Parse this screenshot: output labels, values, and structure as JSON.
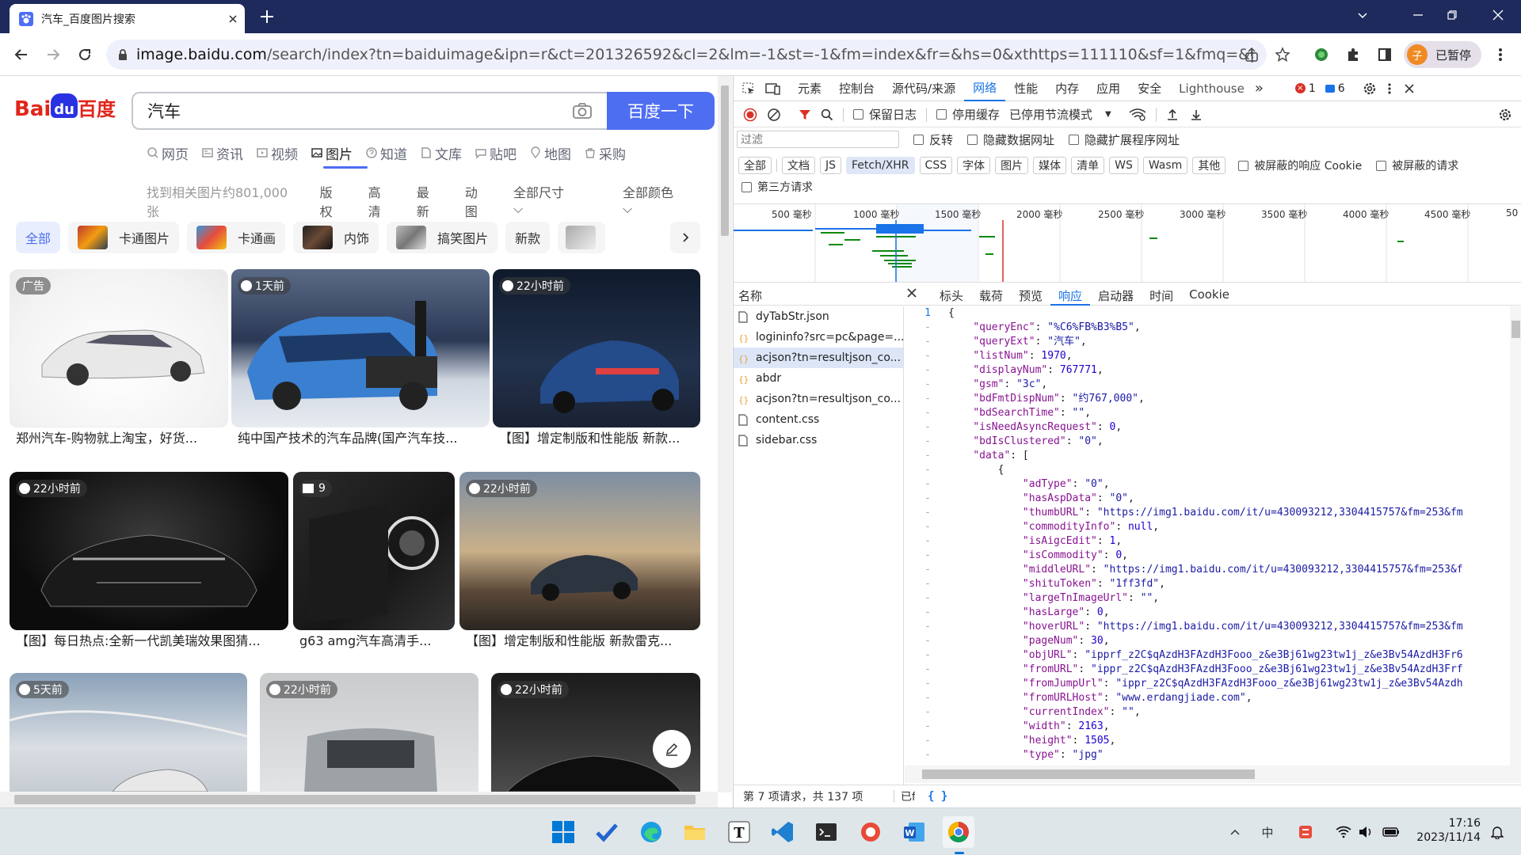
{
  "browser": {
    "tab_title": "汽车_百度图片搜索",
    "url_host": "image.baidu.com",
    "url_rest": "/search/index?tn=baiduimage&ipn=r&ct=201326592&cl=2&lm=-1&st=-1&fm=index&fr=&hs=0&xthttps=111110&sf=1&fmq=&pv=&ic=0&n...",
    "profile_initial": "子",
    "profile_status": "已暂停"
  },
  "page": {
    "logo_text": "Bai",
    "logo_du": "du",
    "logo_cn": "百度",
    "query": "汽车",
    "search_button": "百度一下",
    "nav_tabs": [
      "网页",
      "资讯",
      "视频",
      "图片",
      "知道",
      "文库",
      "贴吧",
      "地图",
      "采购"
    ],
    "result_count": "找到相关图片约801,000张",
    "filters": [
      "版权",
      "高清",
      "最新",
      "动图",
      "全部尺寸",
      "全部颜色"
    ],
    "chips": [
      "全部",
      "卡通图片",
      "卡通画",
      "内饰",
      "搞笑图片",
      "新款"
    ],
    "cards": [
      {
        "badge": "广告",
        "caption": "郑州汽车-购物就上淘宝，好货..."
      },
      {
        "badge": "1天前",
        "caption": "纯中国产技术的汽车品牌(国产汽车技..."
      },
      {
        "badge": "22小时前",
        "caption": "【图】增定制版和性能版 新款..."
      },
      {
        "badge": "22小时前",
        "caption": "【图】每日热点:全新一代凯美瑞效果图猜..."
      },
      {
        "badge": "9",
        "caption": "g63 amg汽车高清手..."
      },
      {
        "badge": "22小时前",
        "caption": "【图】增定制版和性能版 新款雷克..."
      },
      {
        "badge": "5天前",
        "caption": ""
      },
      {
        "badge": "22小时前",
        "caption": ""
      },
      {
        "badge": "22小时前",
        "caption": ""
      }
    ]
  },
  "devtools": {
    "tabs": [
      "元素",
      "控制台",
      "源代码/来源",
      "网络",
      "性能",
      "内存",
      "应用",
      "安全",
      "Lighthouse"
    ],
    "error_count": "1",
    "message_count": "6",
    "toolbar": {
      "preserve_log": "保留日志",
      "disable_cache": "停用缓存",
      "throttle": "已停用节流模式"
    },
    "filter_placeholder": "过滤",
    "filter_checks": [
      "反转",
      "隐藏数据网址",
      "隐藏扩展程序网址"
    ],
    "types": [
      "全部",
      "文档",
      "JS",
      "Fetch/XHR",
      "CSS",
      "字体",
      "图片",
      "媒体",
      "清单",
      "WS",
      "Wasm",
      "其他"
    ],
    "type_checks": [
      "被屏蔽的响应 Cookie",
      "被屏蔽的请求"
    ],
    "third_party": "第三方请求",
    "timeline_ticks": [
      "500 毫秒",
      "1000 毫秒",
      "1500 毫秒",
      "2000 毫秒",
      "2500 毫秒",
      "3000 毫秒",
      "3500 毫秒",
      "4000 毫秒",
      "4500 毫秒",
      "50"
    ],
    "name_header": "名称",
    "detail_tabs": [
      "标头",
      "载荷",
      "预览",
      "响应",
      "启动器",
      "时间",
      "Cookie"
    ],
    "requests": [
      {
        "name": "dyTabStr.json",
        "icon": "doc"
      },
      {
        "name": "logininfo?src=pc&page=...",
        "icon": "xhr"
      },
      {
        "name": "acjson?tn=resultjson_co...",
        "icon": "xhr"
      },
      {
        "name": "abdr",
        "icon": "xhr"
      },
      {
        "name": "acjson?tn=resultjson_co...",
        "icon": "xhr"
      },
      {
        "name": "content.css",
        "icon": "doc"
      },
      {
        "name": "sidebar.css",
        "icon": "doc"
      }
    ],
    "status": "第 7 项请求，共 137 项",
    "status2": "已f",
    "code_lines": [
      {
        "gutter": "1",
        "text": "{"
      },
      {
        "gutter": "-",
        "text": "    \"queryEnc\": \"%C6%FB%B3%B5\","
      },
      {
        "gutter": "-",
        "text": "    \"queryExt\": \"汽车\","
      },
      {
        "gutter": "-",
        "text": "    \"listNum\": 1970,"
      },
      {
        "gutter": "-",
        "text": "    \"displayNum\": 767771,"
      },
      {
        "gutter": "-",
        "text": "    \"gsm\": \"3c\","
      },
      {
        "gutter": "-",
        "text": "    \"bdFmtDispNum\": \"约767,000\","
      },
      {
        "gutter": "-",
        "text": "    \"bdSearchTime\": \"\","
      },
      {
        "gutter": "-",
        "text": "    \"isNeedAsyncRequest\": 0,"
      },
      {
        "gutter": "-",
        "text": "    \"bdIsClustered\": \"0\","
      },
      {
        "gutter": "-",
        "text": "    \"data\": ["
      },
      {
        "gutter": "-",
        "text": "        {"
      },
      {
        "gutter": "-",
        "text": "            \"adType\": \"0\","
      },
      {
        "gutter": "-",
        "text": "            \"hasAspData\": \"0\","
      },
      {
        "gutter": "-",
        "text": "            \"thumbURL\": \"https://img1.baidu.com/it/u=430093212,3304415757&fm=253&fm"
      },
      {
        "gutter": "-",
        "text": "            \"commodityInfo\": null,"
      },
      {
        "gutter": "-",
        "text": "            \"isAigcEdit\": 1,"
      },
      {
        "gutter": "-",
        "text": "            \"isCommodity\": 0,"
      },
      {
        "gutter": "-",
        "text": "            \"middleURL\": \"https://img1.baidu.com/it/u=430093212,3304415757&fm=253&f"
      },
      {
        "gutter": "-",
        "text": "            \"shituToken\": \"1ff3fd\","
      },
      {
        "gutter": "-",
        "text": "            \"largeTnImageUrl\": \"\","
      },
      {
        "gutter": "-",
        "text": "            \"hasLarge\": 0,"
      },
      {
        "gutter": "-",
        "text": "            \"hoverURL\": \"https://img1.baidu.com/it/u=430093212,3304415757&fm=253&fm"
      },
      {
        "gutter": "-",
        "text": "            \"pageNum\": 30,"
      },
      {
        "gutter": "-",
        "text": "            \"objURL\": \"ipprf_z2C$qAzdH3FAzdH3Fooo_z&e3Bj61wg23tw1j_z&e3Bv54AzdH3Fr6"
      },
      {
        "gutter": "-",
        "text": "            \"fromURL\": \"ippr_z2C$qAzdH3FAzdH3Fooo_z&e3Bj61wg23tw1j_z&e3Bv54AzdH3Frf"
      },
      {
        "gutter": "-",
        "text": "            \"fromJumpUrl\": \"ippr_z2C$qAzdH3FAzdH3Fooo_z&e3Bj61wg23tw1j_z&e3Bv54Azdh"
      },
      {
        "gutter": "-",
        "text": "            \"fromURLHost\": \"www.erdangjiade.com\","
      },
      {
        "gutter": "-",
        "text": "            \"currentIndex\": \"\","
      },
      {
        "gutter": "-",
        "text": "            \"width\": 2163,"
      },
      {
        "gutter": "-",
        "text": "            \"height\": 1505,"
      },
      {
        "gutter": "-",
        "text": "            \"type\": \"jpg\""
      }
    ]
  },
  "taskbar": {
    "time": "17:16",
    "date": "2023/11/14",
    "ime": "中"
  },
  "colors": {
    "baidu_blue": "#4e6ef2",
    "title_bar": "#1d2a5b",
    "devtools_active": "#1a73e8"
  }
}
